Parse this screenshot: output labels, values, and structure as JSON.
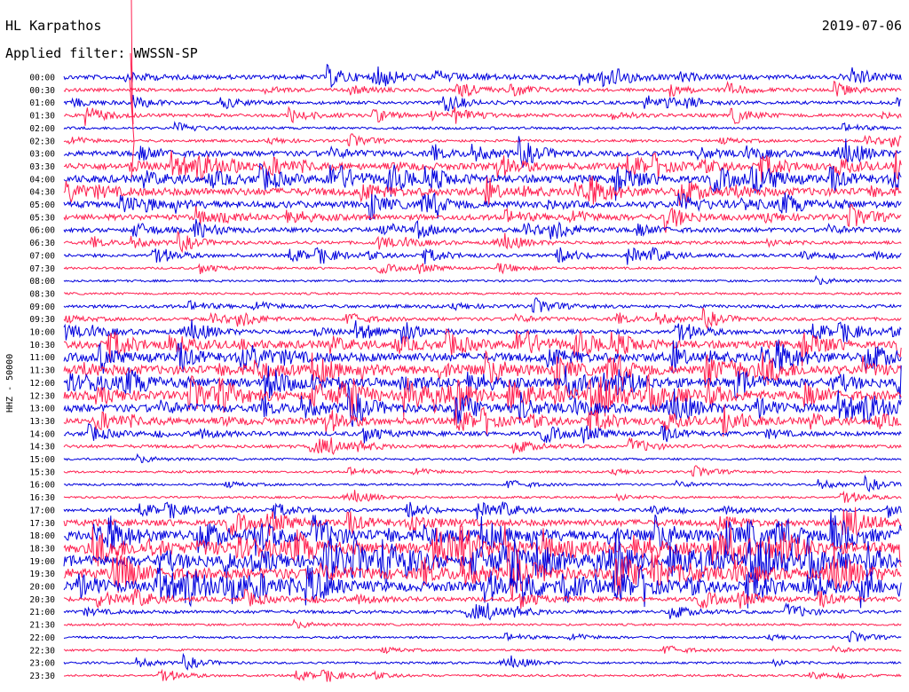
{
  "header": {
    "station": "HL Karpathos",
    "date": "2019-07-06",
    "filter": "Applied filter: WWSSN-SP"
  },
  "ylabel": "HHZ - 50000",
  "colors": {
    "odd_trace": "#0000dd",
    "even_trace": "#ff1f4f"
  },
  "chart_data": {
    "type": "line",
    "title": "",
    "xlabel": "",
    "ylabel": "HHZ - 50000",
    "grid": false,
    "legend": "none",
    "row_labels": [
      "00:00",
      "00:30",
      "01:00",
      "01:30",
      "02:00",
      "02:30",
      "03:00",
      "03:30",
      "04:00",
      "04:30",
      "05:00",
      "05:30",
      "06:00",
      "06:30",
      "07:00",
      "07:30",
      "08:00",
      "08:30",
      "09:00",
      "09:30",
      "10:00",
      "10:30",
      "11:00",
      "11:30",
      "12:00",
      "12:30",
      "13:00",
      "13:30",
      "14:00",
      "14:30",
      "15:00",
      "15:30",
      "16:00",
      "16:30",
      "17:00",
      "17:30",
      "18:00",
      "18:30",
      "19:00",
      "19:30",
      "20:00",
      "20:30",
      "21:00",
      "21:30",
      "22:00",
      "22:30",
      "23:00",
      "23:30"
    ],
    "row_colors": [
      "blue",
      "red"
    ],
    "relative_activity": [
      2,
      1.5,
      1.5,
      1.5,
      1.2,
      1.2,
      2.5,
      3,
      3.5,
      3.5,
      3,
      2.5,
      2,
      1.5,
      1.5,
      1,
      1,
      1,
      1.5,
      1.5,
      2,
      3.5,
      4,
      4,
      4,
      4,
      3.5,
      3,
      2,
      1.5,
      1,
      1,
      1,
      1,
      1.5,
      3,
      4.5,
      5,
      5,
      5,
      4.5,
      2,
      1.5,
      1,
      1,
      1,
      1,
      1
    ]
  }
}
